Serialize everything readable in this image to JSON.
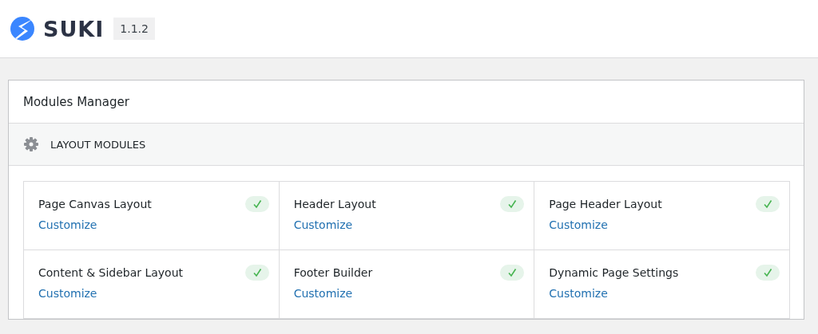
{
  "brand": {
    "name": "SUKI",
    "version": "1.1.2"
  },
  "panel": {
    "title": "Modules Manager",
    "section": {
      "title": "LAYOUT MODULES"
    },
    "modules": [
      {
        "name": "Page Canvas Layout",
        "link": "Customize",
        "active": true
      },
      {
        "name": "Header Layout",
        "link": "Customize",
        "active": true
      },
      {
        "name": "Page Header Layout",
        "link": "Customize",
        "active": true
      },
      {
        "name": "Content & Sidebar Layout",
        "link": "Customize",
        "active": true
      },
      {
        "name": "Footer Builder",
        "link": "Customize",
        "active": true
      },
      {
        "name": "Dynamic Page Settings",
        "link": "Customize",
        "active": true
      }
    ]
  }
}
